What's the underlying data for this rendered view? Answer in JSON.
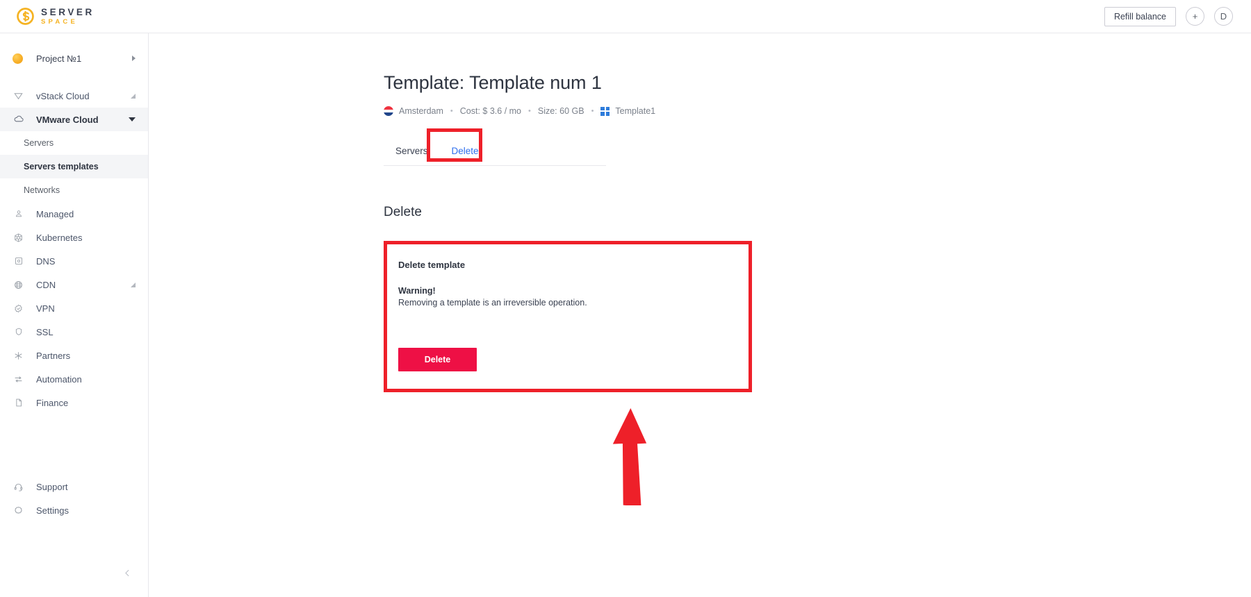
{
  "header": {
    "logo_line1": "SERVER",
    "logo_line2": "SPACE",
    "logo_icon": "serverspace-logo-icon",
    "refill_label": "Refill balance",
    "add_label": "+",
    "avatar_label": "D"
  },
  "sidebar": {
    "project": {
      "label": "Project №1",
      "icon": "project-dot-icon",
      "chevron": "chevron-right-icon"
    },
    "items": [
      {
        "label": "vStack Cloud",
        "icon": "vstack-icon",
        "state": "collapsed",
        "expandable": true
      },
      {
        "label": "VMware Cloud",
        "icon": "cloud-icon",
        "state": "expanded",
        "expandable": true
      },
      {
        "label": "Managed",
        "icon": "managed-icon",
        "state": "normal",
        "expandable": false
      },
      {
        "label": "Kubernetes",
        "icon": "kubernetes-icon",
        "state": "normal",
        "expandable": false
      },
      {
        "label": "DNS",
        "icon": "dns-icon",
        "state": "normal",
        "expandable": false
      },
      {
        "label": "CDN",
        "icon": "cdn-globe-icon",
        "state": "collapsed",
        "expandable": true
      },
      {
        "label": "VPN",
        "icon": "vpn-icon",
        "state": "normal",
        "expandable": false
      },
      {
        "label": "SSL",
        "icon": "shield-icon",
        "state": "normal",
        "expandable": false
      },
      {
        "label": "Partners",
        "icon": "partners-icon",
        "state": "normal",
        "expandable": false
      },
      {
        "label": "Automation",
        "icon": "automation-icon",
        "state": "normal",
        "expandable": false
      },
      {
        "label": "Finance",
        "icon": "finance-doc-icon",
        "state": "normal",
        "expandable": false
      }
    ],
    "subitems": [
      {
        "label": "Servers",
        "active": false
      },
      {
        "label": "Servers templates",
        "active": true
      },
      {
        "label": "Networks",
        "active": false
      }
    ],
    "bottom_items": [
      {
        "label": "Support",
        "icon": "headset-icon"
      },
      {
        "label": "Settings",
        "icon": "gear-icon"
      }
    ],
    "collapse_icon": "chevron-left-icon"
  },
  "main": {
    "page_title": "Template: Template num 1",
    "meta": {
      "location": "Amsterdam",
      "location_icon": "flag-nl-icon",
      "cost": "Cost: $ 3.6 / mo",
      "size": "Size: 60 GB",
      "os_name": "Template1",
      "os_icon": "windows-icon",
      "separator": "•"
    },
    "tabs": [
      {
        "label": "Servers",
        "active": false
      },
      {
        "label": "Delete",
        "active": true
      }
    ],
    "section_title": "Delete",
    "card": {
      "title": "Delete template",
      "warning_title": "Warning!",
      "warning_text": "Removing a template is an irreversible operation.",
      "delete_button": "Delete"
    }
  },
  "annotations": {
    "highlight_color": "#ee2029",
    "arrow_color": "#ee2029",
    "arrow_icon": "arrow-up-annotation-icon",
    "tab_highlight": "delete-tab-highlight",
    "card_highlight": "delete-card-highlight"
  },
  "colors": {
    "accent_blue": "#2f6fed",
    "brand_yellow": "#f5b323",
    "danger_red": "#ee1045",
    "annotation_red": "#ee2029"
  }
}
